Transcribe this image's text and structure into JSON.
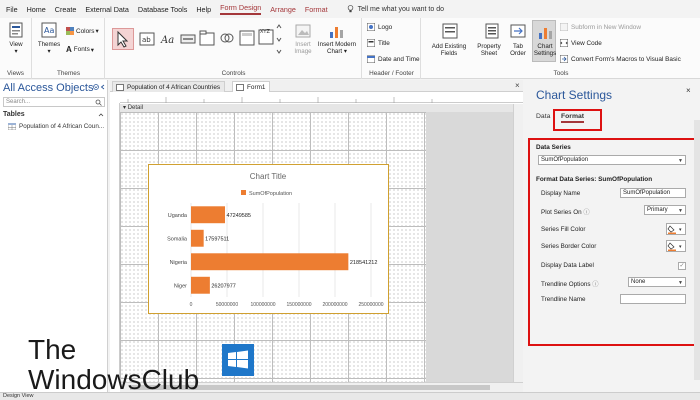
{
  "menu": {
    "items": [
      "File",
      "Home",
      "Create",
      "External Data",
      "Database Tools",
      "Help"
    ],
    "active": "Form Design",
    "extra": [
      "Arrange",
      "Format"
    ],
    "tell_me": "Tell me what you want to do"
  },
  "ribbon": {
    "views": {
      "view": "View",
      "label": "Views"
    },
    "themes": {
      "themes": "Themes",
      "colors": "Colors",
      "fonts": "Fonts",
      "label": "Themes"
    },
    "controls": {
      "label": "Controls",
      "insert_image": "Insert Image",
      "insert_chart": "Insert Modern Chart"
    },
    "header_footer": {
      "logo": "Logo",
      "title": "Title",
      "date_time": "Date and Time",
      "label": "Header / Footer"
    },
    "tools": {
      "add_fields": "Add Existing Fields",
      "property_sheet": "Property Sheet",
      "tab_order": "Tab Order",
      "chart_settings": "Chart Settings",
      "subform": "Subform in New Window",
      "view_code": "View Code",
      "convert_macros": "Convert Form's Macros to Visual Basic",
      "label": "Tools"
    }
  },
  "nav": {
    "title": "All Access Objects",
    "search_placeholder": "Search...",
    "section": "Tables",
    "item": "Population of 4 African Coun..."
  },
  "doc": {
    "tabs": [
      "Population of 4 African Countries",
      "Form1"
    ],
    "section": "Detail"
  },
  "chart_data": {
    "type": "bar",
    "title": "Chart Title",
    "legend": "SumOfPopulation",
    "legend_position": "top",
    "categories": [
      "Uganda",
      "Somalia",
      "Nigeria",
      "Niger"
    ],
    "values": [
      47249585,
      17597511,
      218541212,
      26207977
    ],
    "value_labels": [
      "47249585",
      "17597511",
      "218541212",
      "26207977"
    ],
    "ticks": [
      0,
      50000000,
      100000000,
      150000000,
      200000000,
      250000000
    ],
    "tick_labels": [
      "0",
      "50000000",
      "100000000",
      "150000000",
      "200000000",
      "250000000"
    ],
    "xlim": [
      0,
      250000000
    ],
    "grid": true,
    "color": "#ed7d31"
  },
  "panel": {
    "title": "Chart Settings",
    "tabs": [
      "Data",
      "Format"
    ],
    "data_series_label": "Data Series",
    "data_series_value": "SumOfPopulation",
    "format_heading": "Format Data Series: SumOfPopulation",
    "display_name_label": "Display Name",
    "display_name_value": "SumOfPopulation",
    "plot_on_label": "Plot Series On",
    "plot_on_value": "Primary",
    "fill_label": "Series Fill Color",
    "border_label": "Series Border Color",
    "data_label_label": "Display Data Label",
    "trend_label": "Trendline Options",
    "trend_value": "None",
    "trend_name_label": "Trendline Name"
  },
  "status": {
    "text": "Design View"
  },
  "watermark": {
    "line1": "The",
    "line2": "WindowsClub"
  },
  "colors": {
    "accent": "#a4373a",
    "title_blue": "#2b579a",
    "highlight": "#dd1111",
    "bar": "#ed7d31"
  }
}
